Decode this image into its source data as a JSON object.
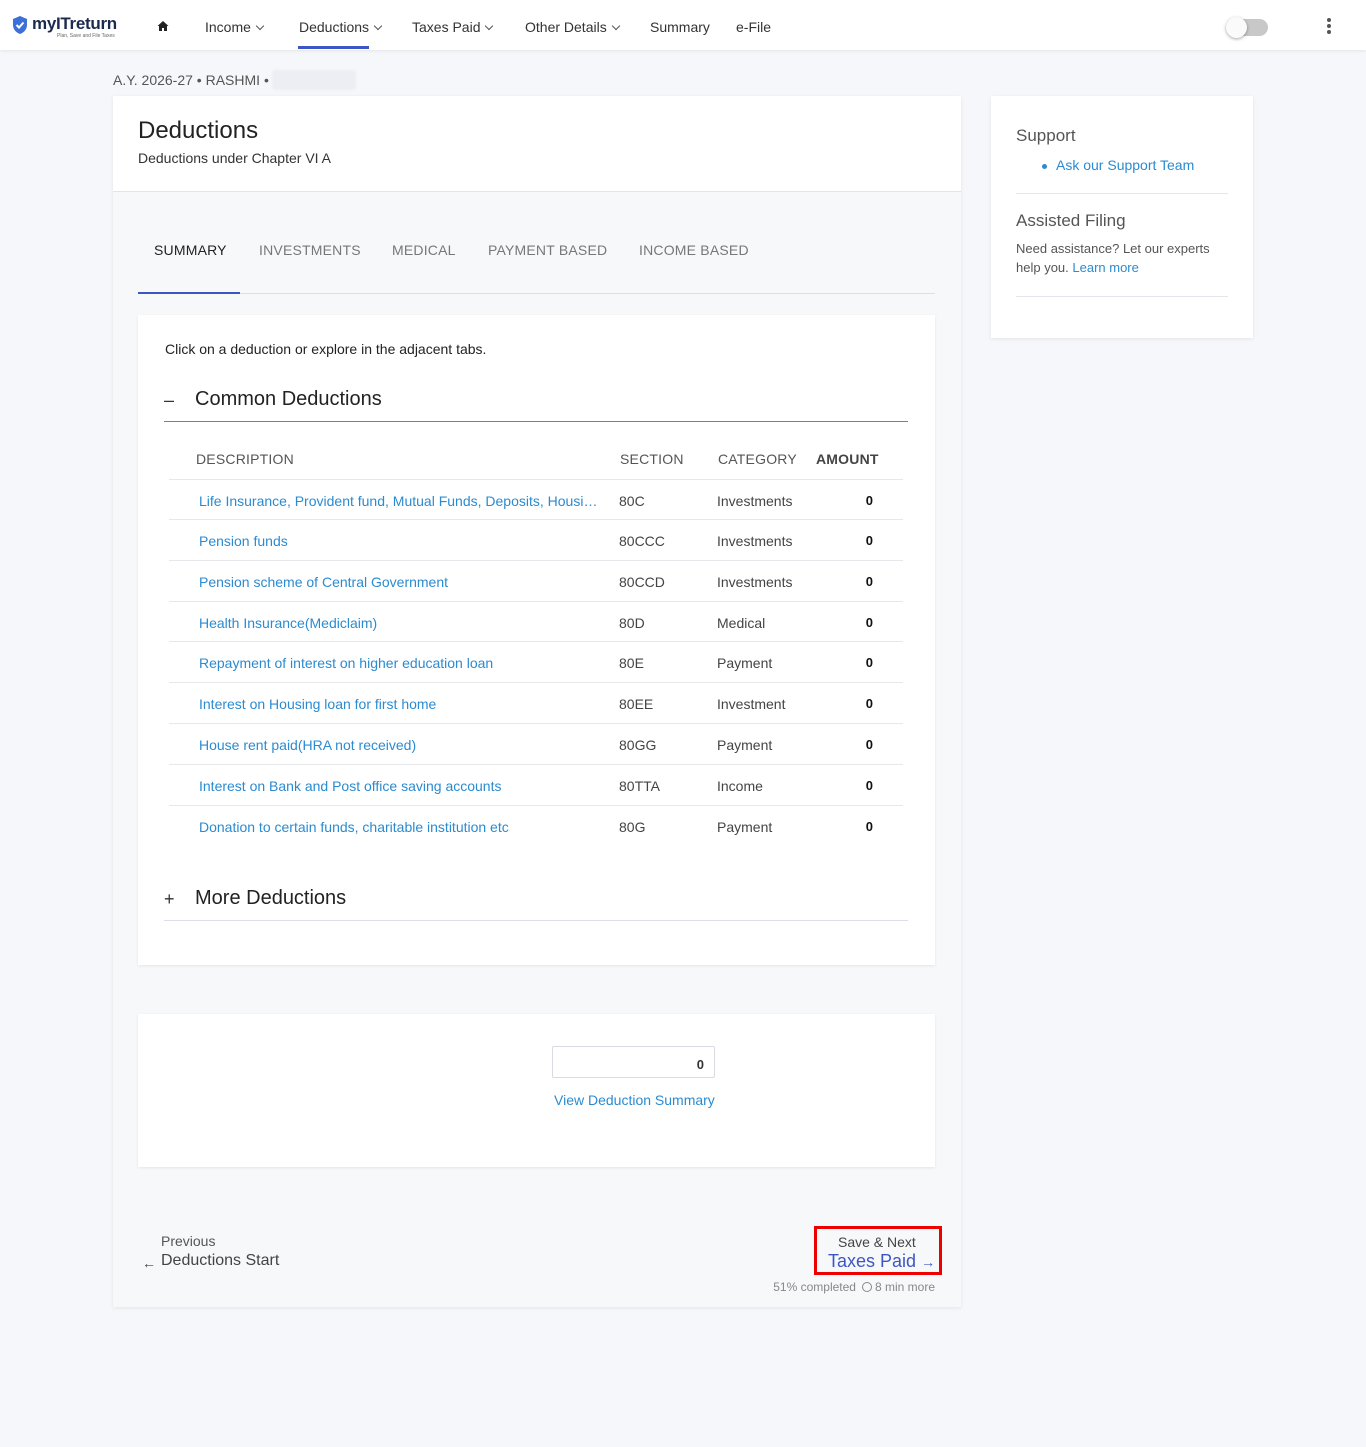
{
  "nav": {
    "brand": "myITreturn",
    "tagline": "Plan, Save and File Taxes",
    "items": [
      {
        "label": "Income",
        "dropdown": true
      },
      {
        "label": "Deductions",
        "dropdown": true,
        "active": true
      },
      {
        "label": "Taxes Paid",
        "dropdown": true
      },
      {
        "label": "Other Details",
        "dropdown": true
      },
      {
        "label": "Summary",
        "dropdown": false
      },
      {
        "label": "e-File",
        "dropdown": false
      }
    ],
    "toggle_on": false,
    "accent_color": "#3d56c4"
  },
  "breadcrumb": "A.Y. 2026-27 • RASHMI •",
  "page": {
    "title": "Deductions",
    "subtitle": "Deductions under Chapter VI A"
  },
  "tabs": [
    {
      "label": "SUMMARY",
      "active": true
    },
    {
      "label": "INVESTMENTS"
    },
    {
      "label": "MEDICAL"
    },
    {
      "label": "PAYMENT BASED"
    },
    {
      "label": "INCOME BASED"
    }
  ],
  "deductions": {
    "hint": "Click on a deduction or explore in the adjacent tabs.",
    "common_title": "Common Deductions",
    "common_sign": "–",
    "more_title": "More Deductions",
    "more_sign": "+",
    "columns": {
      "description": "DESCRIPTION",
      "section": "SECTION",
      "category": "CATEGORY",
      "amount": "AMOUNT"
    },
    "rows": [
      {
        "description": "Life Insurance, Provident fund, Mutual Funds, Deposits, Housing loan principal etc",
        "section": "80C",
        "category": "Investments",
        "amount": "0"
      },
      {
        "description": "Pension funds",
        "section": "80CCC",
        "category": "Investments",
        "amount": "0"
      },
      {
        "description": "Pension scheme of Central Government",
        "section": "80CCD",
        "category": "Investments",
        "amount": "0"
      },
      {
        "description": "Health Insurance(Mediclaim)",
        "section": "80D",
        "category": "Medical",
        "amount": "0"
      },
      {
        "description": "Repayment of interest on higher education loan",
        "section": "80E",
        "category": "Payment",
        "amount": "0"
      },
      {
        "description": "Interest on Housing loan for first home",
        "section": "80EE",
        "category": "Investment",
        "amount": "0"
      },
      {
        "description": "House rent paid(HRA not received)",
        "section": "80GG",
        "category": "Payment",
        "amount": "0"
      },
      {
        "description": "Interest on Bank and Post office saving accounts",
        "section": "80TTA",
        "category": "Income",
        "amount": "0"
      },
      {
        "description": "Donation to certain funds, charitable institution etc",
        "section": "80G",
        "category": "Payment",
        "amount": "0"
      }
    ]
  },
  "summary": {
    "total": "0",
    "link": "View Deduction Summary"
  },
  "footer": {
    "prev_label": "Previous",
    "prev_title": "Deductions Start",
    "next_label": "Save & Next",
    "next_title": "Taxes Paid",
    "progress_text": "51% completed",
    "time_text": "8 min more"
  },
  "side": {
    "support_title": "Support",
    "support_link": "Ask our Support Team",
    "assisted_title": "Assisted Filing",
    "assisted_text": "Need assistance? Let our experts help you.",
    "assisted_link": "Learn more"
  }
}
